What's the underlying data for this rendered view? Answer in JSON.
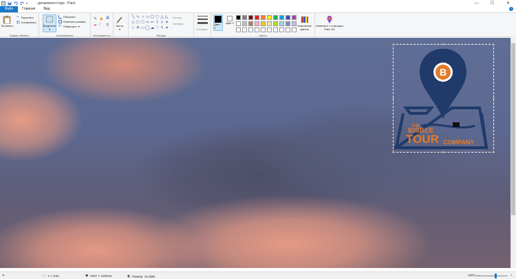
{
  "window": {
    "title": "- делаемлогo logo - Paint",
    "controls": {
      "minimize": "—",
      "maximize": "☐",
      "close": "✕"
    }
  },
  "tabs": [
    {
      "label": "Файл"
    },
    {
      "label": "Главная"
    },
    {
      "label": "Вид"
    }
  ],
  "ribbon": {
    "clipboard": {
      "paste": "Вставить",
      "cut": "Вырезать",
      "copy": "Копировать",
      "label": "Буфер обмена"
    },
    "image": {
      "select": "Выделить",
      "crop": "Обрезать",
      "resize": "Изменить размер",
      "rotate": "Повернуть",
      "label": "Изображение"
    },
    "tools": {
      "label": "Инструменты",
      "brushes": "Кисти"
    },
    "shapes": {
      "outline": "Контур",
      "fill": "Заливка",
      "label": "Фигуры",
      "size": "Толщина"
    },
    "colors": {
      "color1": "Цвет 1",
      "color2": "Цвет 2",
      "edit": "Изменение цветов",
      "label": "Цвета",
      "paint3d": "Изменить с помощью Paint 3D",
      "swatches": [
        "#000000",
        "#7f7f7f",
        "#880015",
        "#ed1c24",
        "#ff7f27",
        "#fff200",
        "#22b14c",
        "#00a2e8",
        "#3f48cc",
        "#a349a4",
        "#ffffff",
        "#c3c3c3",
        "#b97a57",
        "#ffaec9",
        "#ffc90e",
        "#efe4b0",
        "#b5e61d",
        "#99d9ea",
        "#7092be",
        "#c8bfe7",
        "#ffffff",
        "#ffffff",
        "#ffffff",
        "#ffffff",
        "#ffffff",
        "#ffffff",
        "#ffffff",
        "#ffffff",
        "#ffffff",
        "#ffffff"
      ]
    }
  },
  "logo": {
    "letter": "B",
    "line1": "THE",
    "line2": "BISBEE",
    "line3": "TOUR",
    "line4": "COMPANY",
    "navy": "#1f3a6b",
    "orange": "#e07c2e"
  },
  "status": {
    "selection_size": "1 × 1пкс",
    "image_size": "6287 × 4193пкс",
    "file_size": "Размер: 15,3МБ",
    "zoom": "100%"
  }
}
